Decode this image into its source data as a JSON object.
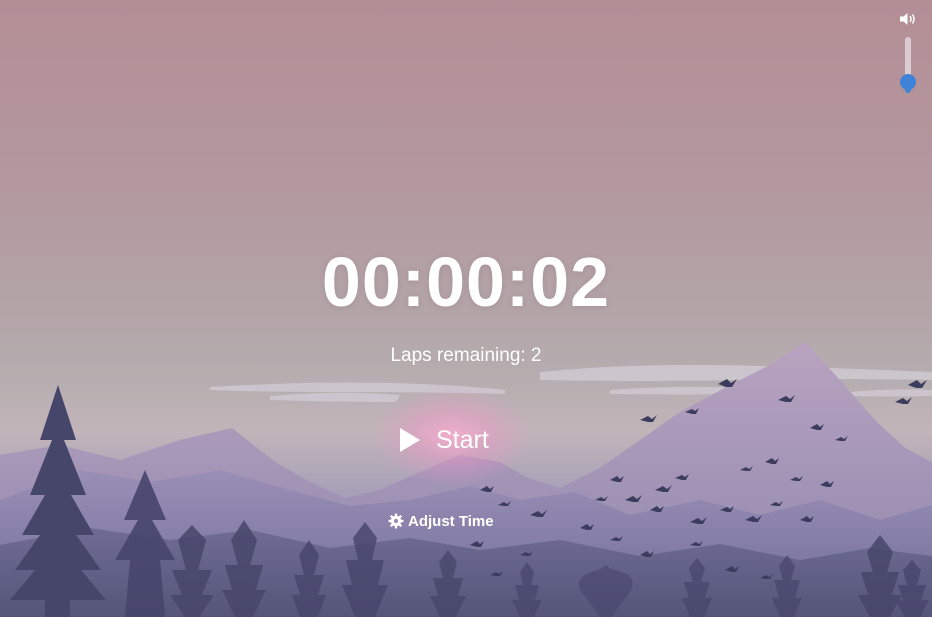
{
  "timer": {
    "display": "00:00:02"
  },
  "laps": {
    "text": "Laps remaining: 2"
  },
  "controls": {
    "start_label": "Start",
    "adjust_label": "Adjust Time"
  },
  "volume": {
    "level": 0.2,
    "accent": "#3f83d8"
  },
  "icons": {
    "volume": "speaker-icon",
    "play": "play-icon",
    "gear": "gear-icon"
  },
  "colors": {
    "text": "#ffffff",
    "sky_top": "#b48e95",
    "mountain": "#8b86ad",
    "trees": "#4a4866"
  }
}
